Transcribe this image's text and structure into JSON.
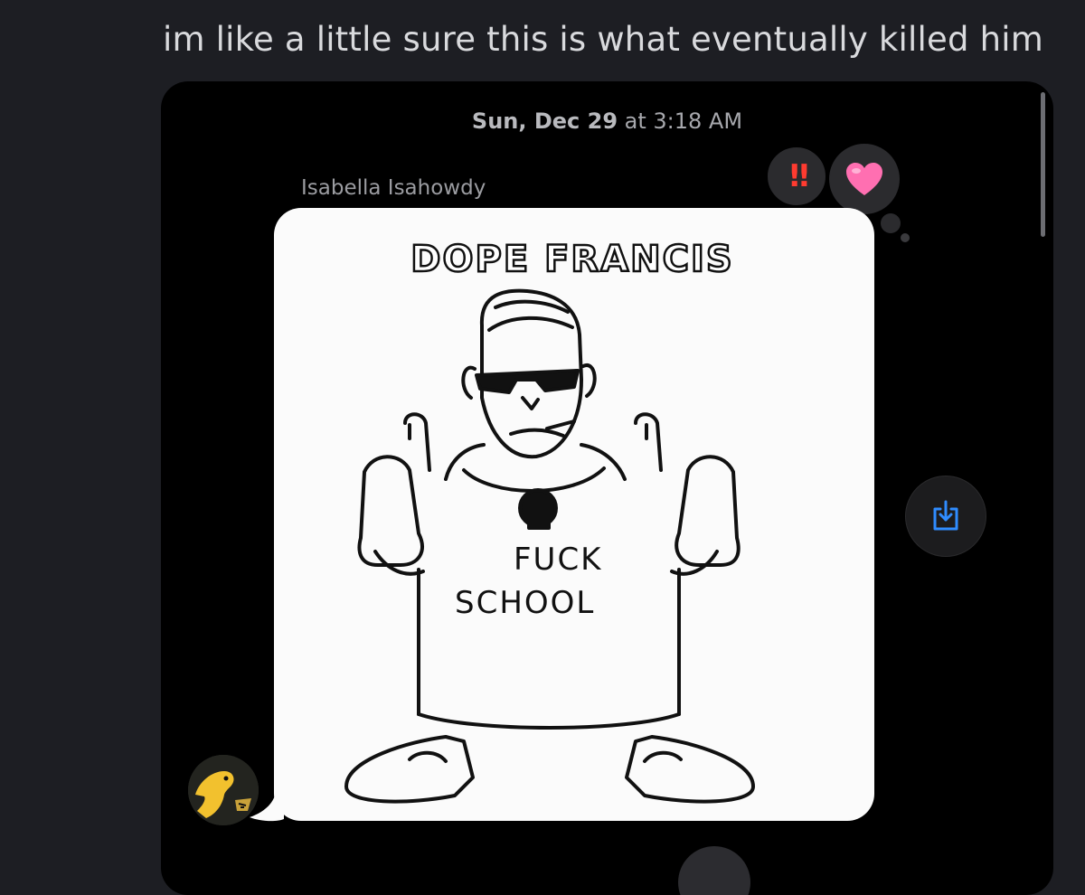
{
  "caption": "im like a little sure this is what eventually killed him",
  "thread": {
    "timestamp_day": "Sun, Dec 29",
    "timestamp_at": " at ",
    "timestamp_time": "3:18 AM",
    "sender": "Isabella Isahowdy"
  },
  "reactions": [
    {
      "icon": "double-exclamation-icon",
      "label": "‼"
    },
    {
      "icon": "heart-icon",
      "color": "#ff5fa8"
    }
  ],
  "image": {
    "title": "DOPE FRANCIS",
    "shirt_line1": "FUCK",
    "shirt_line2": "SCHOOL"
  },
  "colors": {
    "accent": "#2f8cff",
    "heart": "#ff5fa8",
    "background": "#1d1e23"
  }
}
